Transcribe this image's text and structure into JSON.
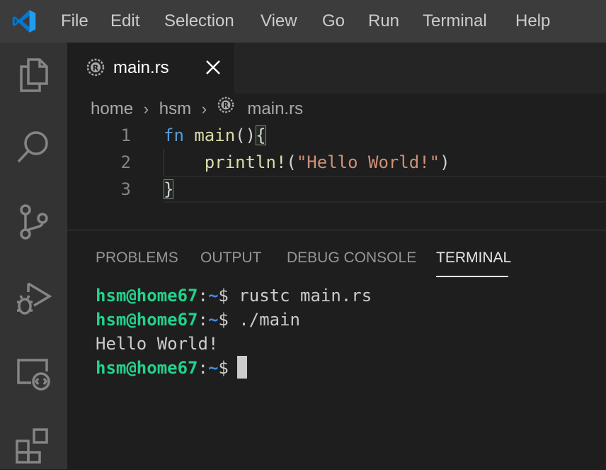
{
  "menu": [
    "File",
    "Edit",
    "Selection",
    "View",
    "Go",
    "Run",
    "Terminal",
    "Help"
  ],
  "activity_bar": [
    "explorer-icon",
    "search-icon",
    "source-control-icon",
    "run-debug-icon",
    "remote-explorer-icon",
    "extensions-icon"
  ],
  "tab": {
    "filename": "main.rs"
  },
  "breadcrumb": {
    "part1": "home",
    "part2": "hsm",
    "part3": "main.rs"
  },
  "editor": {
    "line_numbers": [
      "1",
      "2",
      "3"
    ],
    "code": {
      "l1_kw": "fn",
      "l1_fn": "main",
      "l1_rest": "()",
      "l1_brace": "{",
      "l2_indent": "    ",
      "l2_macro": "println!",
      "l2_open": "(",
      "l2_str": "\"Hello World!\"",
      "l2_close": ")",
      "l3_brace": "}"
    }
  },
  "panel": {
    "tabs": [
      "PROBLEMS",
      "OUTPUT",
      "DEBUG CONSOLE",
      "TERMINAL"
    ],
    "active_tab": "TERMINAL"
  },
  "terminal": {
    "user": "hsm@home67",
    "colon": ":",
    "path": "~",
    "prompt": "$",
    "cmd1": " rustc main.rs",
    "cmd2": " ./main",
    "output": "Hello World!"
  },
  "colors": {
    "accent": "#0078d4",
    "prompt_user": "#23d18b",
    "prompt_path": "#3b8eea",
    "keyword": "#569cd6",
    "function": "#dcdcaa",
    "string": "#ce9178"
  }
}
